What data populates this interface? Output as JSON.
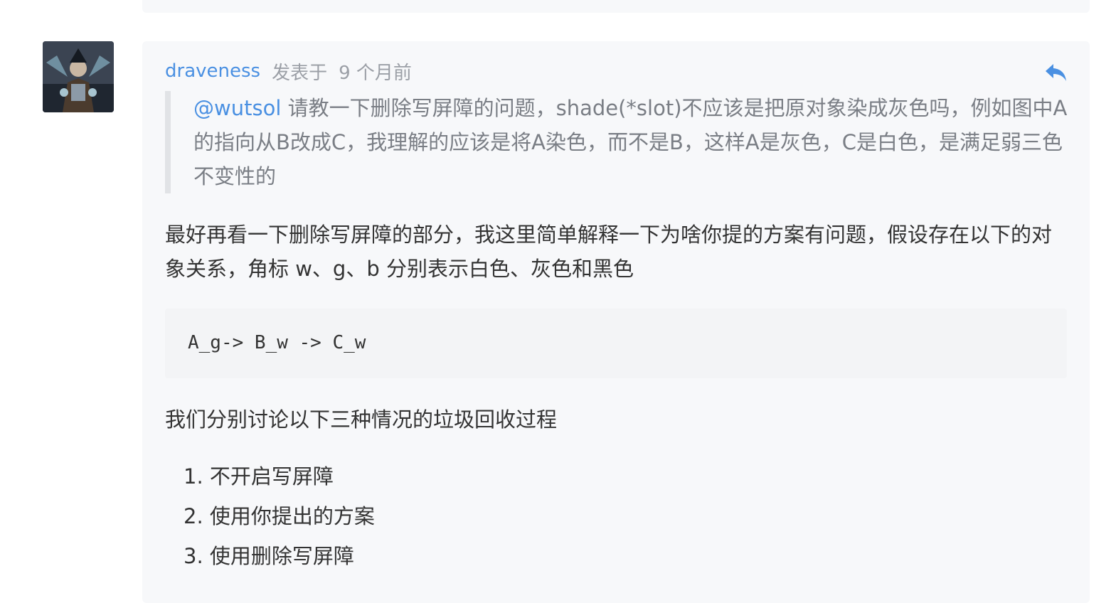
{
  "comment": {
    "author": "draveness",
    "posted_label": "发表于",
    "time": "9 个月前",
    "quote": {
      "mention": "@wutsol",
      "text": " 请教一下删除写屏障的问题，shade(*slot)不应该是把原对象染成灰色吗，例如图中A的指向从B改成C，我理解的应该是将A染色，而不是B，这样A是灰色，C是白色，是满足弱三色不变性的"
    },
    "paragraph1": "最好再看一下删除写屏障的部分，我这里简单解释一下为啥你提的方案有问题，假设存在以下的对象关系，角标 w、g、b 分别表示白色、灰色和黑色",
    "code": "A_g-> B_w -> C_w",
    "paragraph2": "我们分别讨论以下三种情况的垃圾回收过程",
    "list": [
      "1. 不开启写屏障",
      "2. 使用你提出的方案",
      "3. 使用删除写屏障"
    ]
  },
  "icons": {
    "reply": "reply-arrow-icon",
    "avatar": "user-avatar-image"
  },
  "colors": {
    "link": "#4a90e2",
    "muted": "#9b9fa6",
    "quote_text": "#7a7e85",
    "body_text": "#333333",
    "card_bg": "#f7f8fa",
    "code_bg": "#f3f4f6",
    "quote_border": "#e1e3e6"
  }
}
